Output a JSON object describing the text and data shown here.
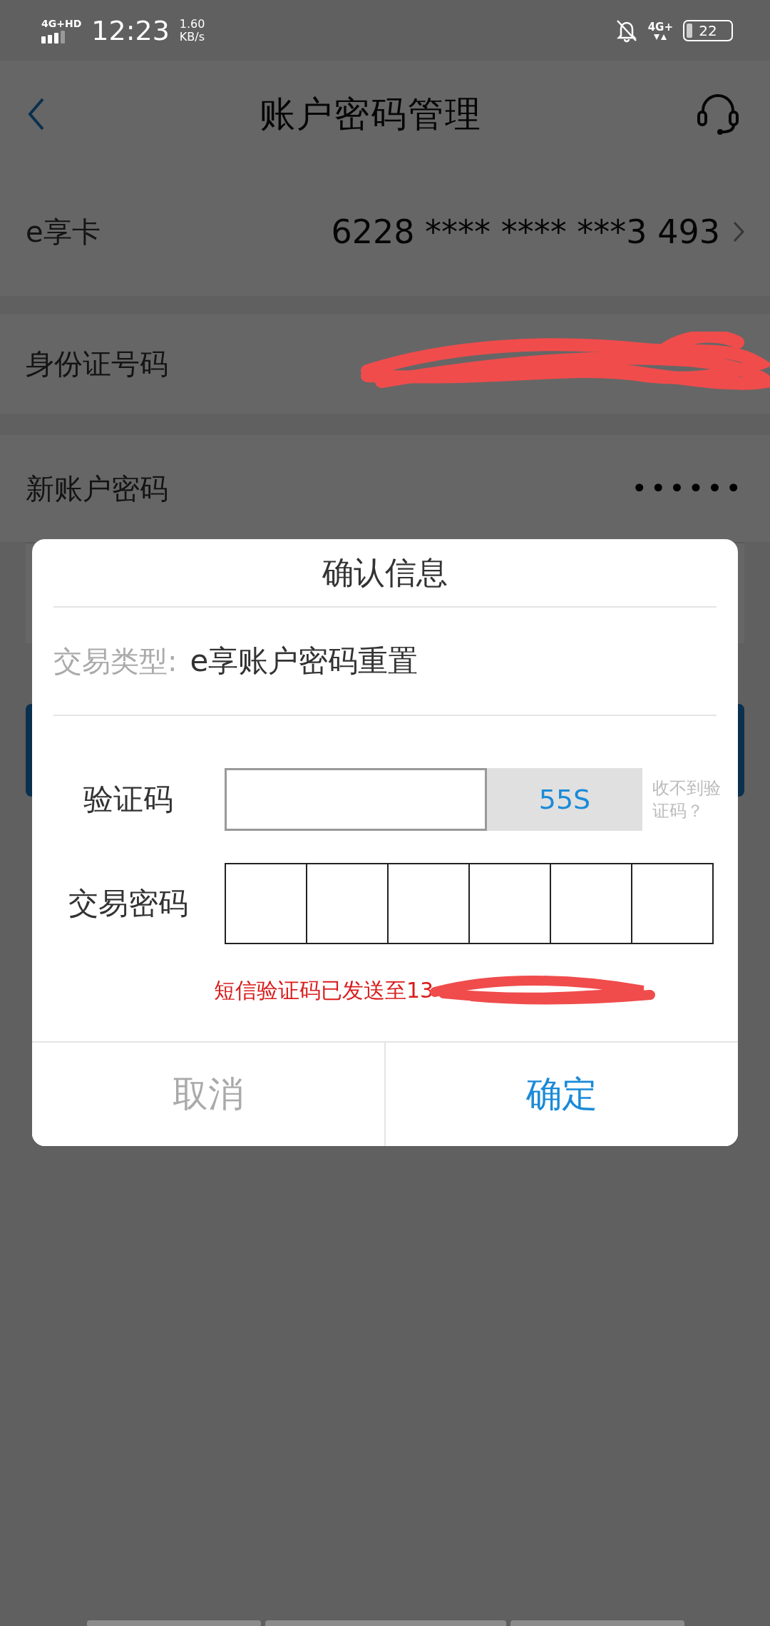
{
  "status_bar": {
    "network": "4G+HD",
    "time": "12:23",
    "speed_value": "1.60",
    "speed_unit": "KB/s",
    "data_network": "4G+",
    "battery": "22"
  },
  "nav": {
    "title": "账户密码管理"
  },
  "rows": [
    {
      "kind": "value",
      "label": "e享卡",
      "value": "6228 **** **** ***3 493"
    },
    {
      "kind": "redacted",
      "label": "身份证号码"
    },
    {
      "kind": "password",
      "label": "新账户密码",
      "value": "••••••"
    }
  ],
  "dialog": {
    "title": "确认信息",
    "trade_type_label": "交易类型:",
    "trade_type_value": "e享账户密码重置",
    "code_label": "验证码",
    "countdown": "55S",
    "help_link": "收不到验证码？",
    "password_label": "交易密码",
    "sms_notice": "短信验证码已发送至13",
    "buttons": [
      {
        "kind": "cancel",
        "label": "取消"
      },
      {
        "kind": "confirm",
        "label": "确定"
      }
    ]
  }
}
